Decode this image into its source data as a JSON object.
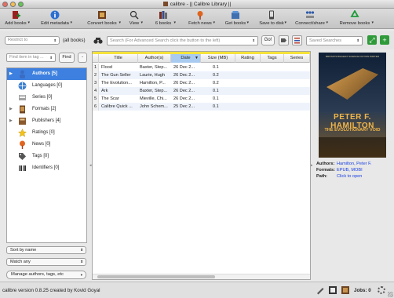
{
  "window": {
    "title": "calibre - || Calibre Library ||"
  },
  "toolbar": {
    "buttons": [
      {
        "label": "Add books",
        "icon": "add-book-icon"
      },
      {
        "label": "Edit metadata",
        "icon": "info-icon"
      },
      {
        "label": "Convert books",
        "icon": "convert-icon"
      },
      {
        "label": "View",
        "icon": "magnifier-icon"
      },
      {
        "label": "6 books",
        "icon": "library-icon"
      },
      {
        "label": "Fetch news",
        "icon": "news-icon"
      },
      {
        "label": "Get books",
        "icon": "store-icon"
      },
      {
        "label": "Save to disk",
        "icon": "save-icon"
      },
      {
        "label": "Connect/share",
        "icon": "connect-icon"
      },
      {
        "label": "Remove books",
        "icon": "recycle-icon"
      }
    ]
  },
  "searchbar": {
    "restrict_placeholder": "Restrict to",
    "all_books": "(all books)",
    "search_placeholder": "Search (For Advanced Search click the button to the left)",
    "go_label": "Go!",
    "saved_searches_placeholder": "Saved Searches"
  },
  "tag_browser": {
    "find_placeholder": "Find item in tag ...",
    "find_button": "Find",
    "minus_button": "-",
    "items": [
      {
        "label": "Authors [5]",
        "icon": "authors-icon",
        "expandable": true,
        "selected": true
      },
      {
        "label": "Languages [0]",
        "icon": "languages-icon",
        "expandable": false,
        "selected": false
      },
      {
        "label": "Series [0]",
        "icon": "series-icon",
        "expandable": false,
        "selected": false
      },
      {
        "label": "Formats [2]",
        "icon": "formats-icon",
        "expandable": true,
        "selected": false
      },
      {
        "label": "Publishers [4]",
        "icon": "publishers-icon",
        "expandable": true,
        "selected": false
      },
      {
        "label": "Ratings [0]",
        "icon": "ratings-icon",
        "expandable": false,
        "selected": false
      },
      {
        "label": "News [0]",
        "icon": "news-icon",
        "expandable": false,
        "selected": false
      },
      {
        "label": "Tags [0]",
        "icon": "tags-icon",
        "expandable": false,
        "selected": false
      },
      {
        "label": "Identifiers [0]",
        "icon": "identifiers-icon",
        "expandable": false,
        "selected": false
      }
    ],
    "sort_by": "Sort by name",
    "match": "Match any",
    "manage": "Manage authors, tags, etc"
  },
  "books_table": {
    "columns": [
      "Title",
      "Author(s)",
      "Date",
      "Size (MB)",
      "Rating",
      "Tags",
      "Series"
    ],
    "sorted_column": "Date",
    "rows": [
      {
        "n": "1",
        "title": "Flood",
        "author": "Baxter, Step...",
        "date": "26 Dec 2...",
        "size": "0.1"
      },
      {
        "n": "2",
        "title": "The Gun Seller",
        "author": "Laurie, Hugh",
        "date": "26 Dec 2...",
        "size": "0.2"
      },
      {
        "n": "3",
        "title": "The Evolution...",
        "author": "Hamilton, P...",
        "date": "26 Dec 2...",
        "size": "0.2"
      },
      {
        "n": "4",
        "title": "Ark",
        "author": "Baxter, Step...",
        "date": "26 Dec 2...",
        "size": "0.1"
      },
      {
        "n": "5",
        "title": "The Scar",
        "author": "Mieville, Chi...",
        "date": "26 Dec 2...",
        "size": "0.1"
      },
      {
        "n": "6",
        "title": "Calibre Quick ...",
        "author": "John Schem...",
        "date": "25 Dec 2...",
        "size": "0.1"
      }
    ]
  },
  "details": {
    "cover": {
      "top_text": "BRITAIN'S BIGGEST SCIENCE FICTION WRITER",
      "author": "PETER F. HAMILTON",
      "title": "THE EVOLUTIONARY VOID"
    },
    "authors_label": "Authors:",
    "authors_value": "Hamilton, Peter F.",
    "formats_label": "Formats:",
    "formats_value": "EPUB, MOBI",
    "path_label": "Path:",
    "path_value": "Click to open"
  },
  "status": {
    "text": "calibre version 0.8.25 created by Kovid Goyal",
    "jobs": "Jobs: 0"
  }
}
